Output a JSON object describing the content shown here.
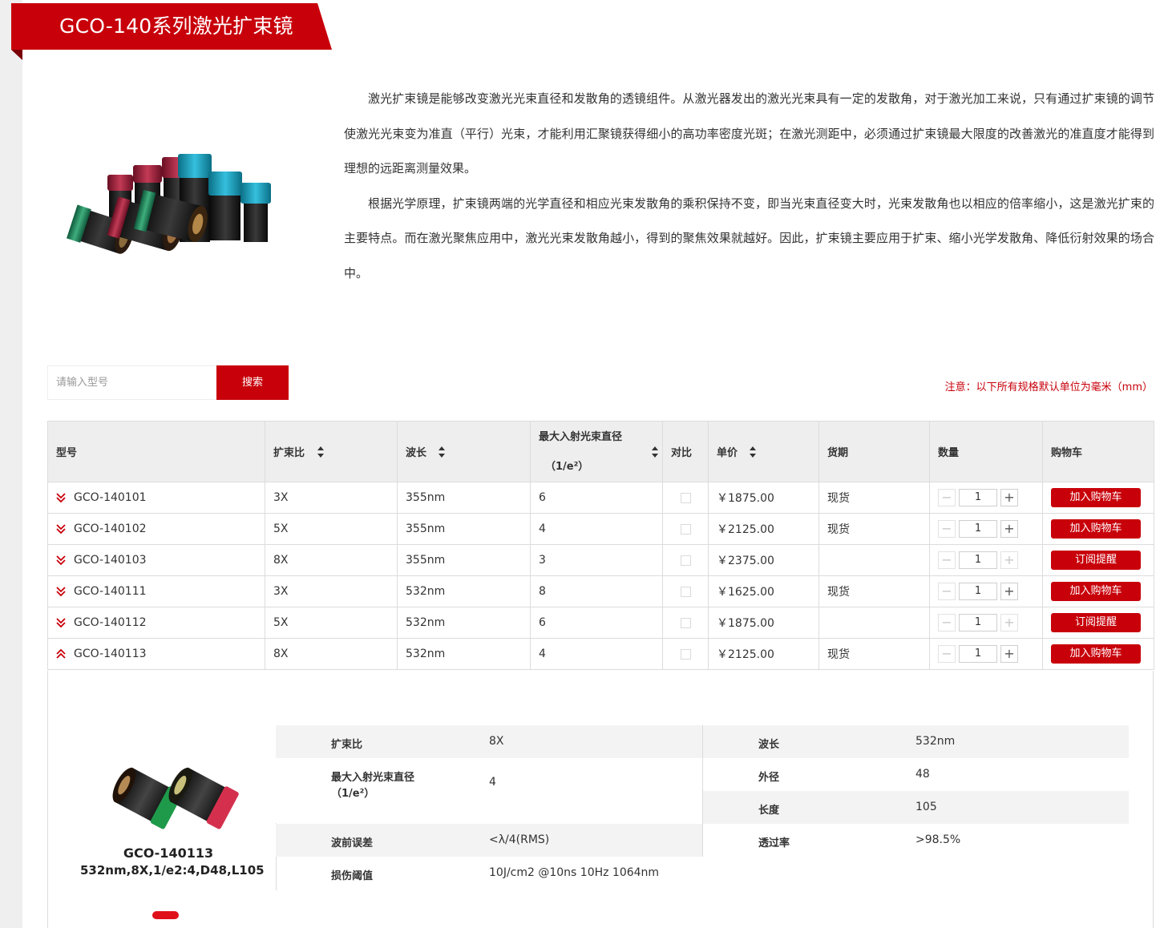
{
  "header": {
    "title": "GCO-140系列激光扩束镜"
  },
  "intro": {
    "paragraphs": [
      "激光扩束镜是能够改变激光光束直径和发散角的透镜组件。从激光器发出的激光光束具有一定的发散角，对于激光加工来说，只有通过扩束镜的调节使激光光束变为准直（平行）光束，才能利用汇聚镜获得细小的高功率密度光斑；在激光测距中，必须通过扩束镜最大限度的改善激光的准直度才能得到理想的远距离测量效果。",
      "根据光学原理，扩束镜两端的光学直径和相应光束发散角的乘积保持不变，即当光束直径变大时，光束发散角也以相应的倍率缩小，这是激光扩束的主要特点。而在激光聚焦应用中，激光光束发散角越小，得到的聚焦效果就越好。因此，扩束镜主要应用于扩束、缩小光学发散角、降低衍射效果的场合中。"
    ]
  },
  "search": {
    "placeholder": "请输入型号",
    "button_label": "搜索"
  },
  "note": "注意：以下所有规格默认单位为毫米（mm）",
  "table": {
    "headers": {
      "model": "型号",
      "ratio": "扩束比",
      "wavelength": "波长",
      "max_beam_line1": "最大入射光束直径",
      "max_beam_line2": "（1/e²）",
      "compare": "对比",
      "price": "单价",
      "stock": "货期",
      "qty": "数量",
      "cart": "购物车"
    },
    "rows": [
      {
        "model": "GCO-140101",
        "ratio": "3X",
        "wavelength": "355nm",
        "max_beam": "6",
        "price": "￥1875.00",
        "stock": "现货",
        "qty": "1",
        "action": "加入购物车",
        "expanded": false,
        "plus_enabled": true
      },
      {
        "model": "GCO-140102",
        "ratio": "5X",
        "wavelength": "355nm",
        "max_beam": "4",
        "price": "￥2125.00",
        "stock": "现货",
        "qty": "1",
        "action": "加入购物车",
        "expanded": false,
        "plus_enabled": true
      },
      {
        "model": "GCO-140103",
        "ratio": "8X",
        "wavelength": "355nm",
        "max_beam": "3",
        "price": "￥2375.00",
        "stock": "",
        "qty": "1",
        "action": "订阅提醒",
        "expanded": false,
        "plus_enabled": false
      },
      {
        "model": "GCO-140111",
        "ratio": "3X",
        "wavelength": "532nm",
        "max_beam": "8",
        "price": "￥1625.00",
        "stock": "现货",
        "qty": "1",
        "action": "加入购物车",
        "expanded": false,
        "plus_enabled": true
      },
      {
        "model": "GCO-140112",
        "ratio": "5X",
        "wavelength": "532nm",
        "max_beam": "6",
        "price": "￥1875.00",
        "stock": "",
        "qty": "1",
        "action": "订阅提醒",
        "expanded": false,
        "plus_enabled": false
      },
      {
        "model": "GCO-140113",
        "ratio": "8X",
        "wavelength": "532nm",
        "max_beam": "4",
        "price": "￥2125.00",
        "stock": "现货",
        "qty": "1",
        "action": "加入购物车",
        "expanded": true,
        "plus_enabled": true
      }
    ]
  },
  "detail": {
    "model": "GCO-140113",
    "desc": "532nm,8X,1/e2:4,D48,L105",
    "specs": {
      "ratio_label": "扩束比",
      "ratio": "8X",
      "wavelength_label": "波长",
      "wavelength": "532nm",
      "beam_label_1": "最大入射光束直径",
      "beam_label_2": "（1/e²）",
      "beam": "4",
      "od_label": "外径",
      "od": "48",
      "length_label": "长度",
      "length": "105",
      "wfe_label": "波前误差",
      "wfe": "<λ/4(RMS)",
      "trans_label": "透过率",
      "trans": ">98.5%",
      "damage_label": "损伤阈值",
      "damage": "10J/cm2 @10ns 10Hz 1064nm"
    }
  },
  "colors": {
    "brand_red": "#c8000a",
    "header_bg": "#eeeeee"
  }
}
